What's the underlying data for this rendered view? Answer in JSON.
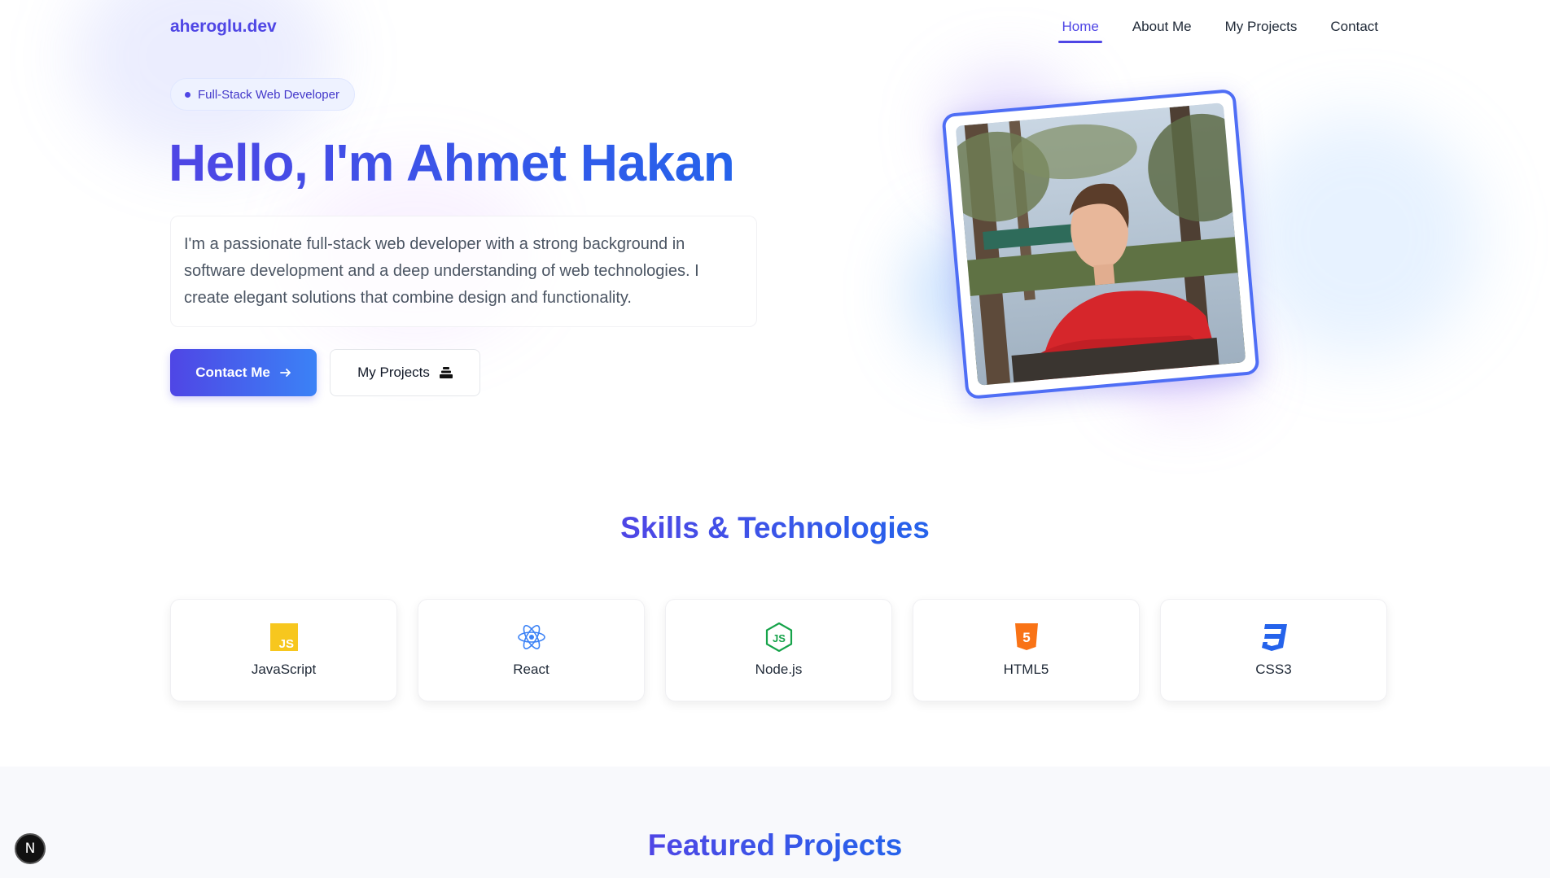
{
  "nav": {
    "logo": "aheroglu.dev",
    "links": [
      "Home",
      "About Me",
      "My Projects",
      "Contact"
    ],
    "active": "Home"
  },
  "hero": {
    "badge": "Full-Stack Web Developer",
    "title": "Hello, I'm Ahmet Hakan",
    "description": "I'm a passionate full-stack web developer with a strong background in software development and a deep understanding of web technologies. I create elegant solutions that combine design and functionality.",
    "primary_button": "Contact Me",
    "primary_button_icon": "arrow-right-icon",
    "secondary_button": "My Projects",
    "secondary_button_icon": "stack-icon"
  },
  "skills": {
    "title": "Skills & Technologies",
    "items": [
      {
        "label": "JavaScript",
        "icon": "javascript-icon",
        "color": "#f7df1e"
      },
      {
        "label": "React",
        "icon": "react-icon",
        "color": "#3b82f6"
      },
      {
        "label": "Node.js",
        "icon": "nodejs-icon",
        "color": "#16a34a"
      },
      {
        "label": "HTML5",
        "icon": "html5-icon",
        "color": "#f97316"
      },
      {
        "label": "CSS3",
        "icon": "css3-icon",
        "color": "#2563eb"
      }
    ]
  },
  "projects": {
    "title": "Featured Projects"
  },
  "dev_badge": "N",
  "colors": {
    "accent": "#4f46e5",
    "accent_blue": "#2563eb"
  }
}
